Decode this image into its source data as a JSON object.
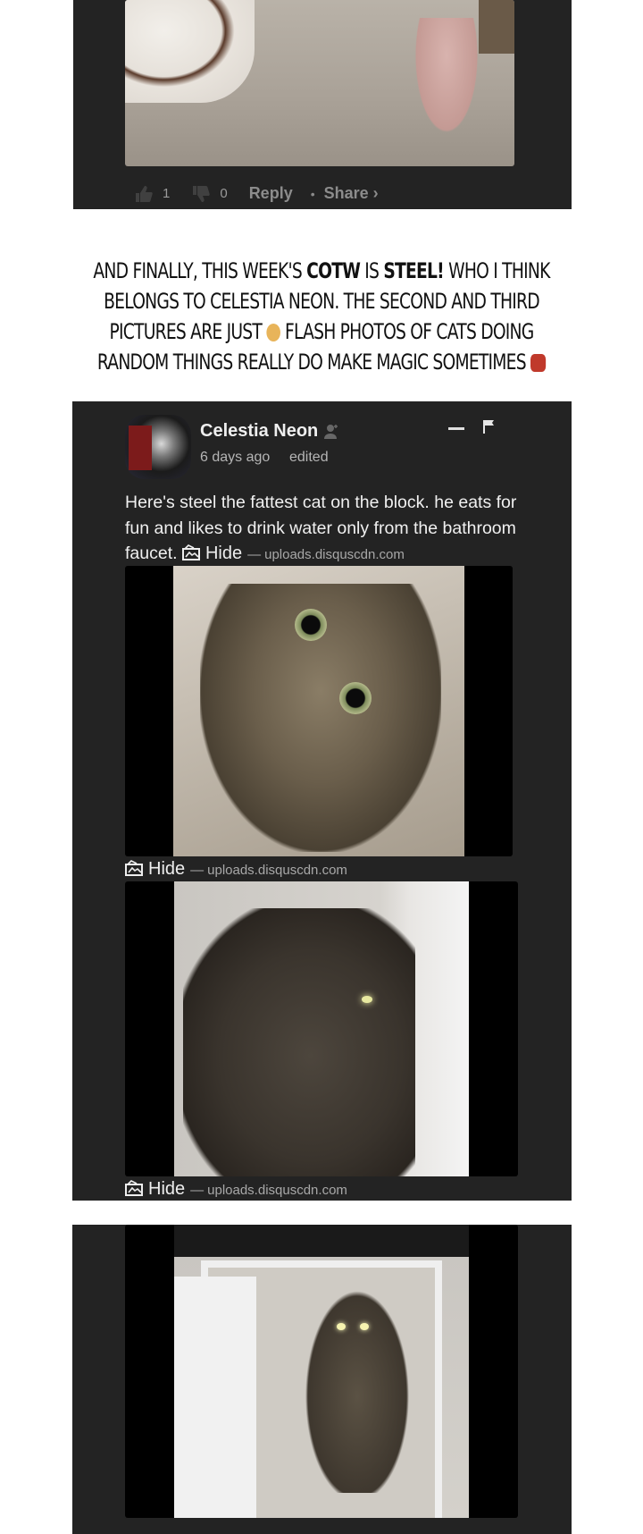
{
  "top_comment": {
    "upvotes": "1",
    "downvotes": "0",
    "reply_label": "Reply",
    "share_label": "Share ›",
    "separator": "•"
  },
  "caption": {
    "part1": "And finally, this week's ",
    "cotw": "COTW",
    "part2": " is ",
    "steel": "Steel!",
    "part3": " Who I think belongs to Celestia Neon. The second and third pictures are just ",
    "part4": " flash photos of cats doing random things really do make magic sometimes "
  },
  "comment": {
    "author": "Celestia Neon",
    "time": "6 days ago",
    "edited": "edited",
    "text": "Here's steel the fattest cat on the block. he eats for fun and likes to drink water only from the bathroom faucet.",
    "hide_label": "Hide",
    "dash": "—",
    "source": "uploads.disquscdn.com"
  },
  "icons": {
    "upvote": "thumbs-up-icon",
    "downvote": "thumbs-down-icon",
    "collapse": "minus-icon",
    "flag": "flag-icon",
    "image": "image-icon",
    "badge": "user-badge-icon"
  }
}
